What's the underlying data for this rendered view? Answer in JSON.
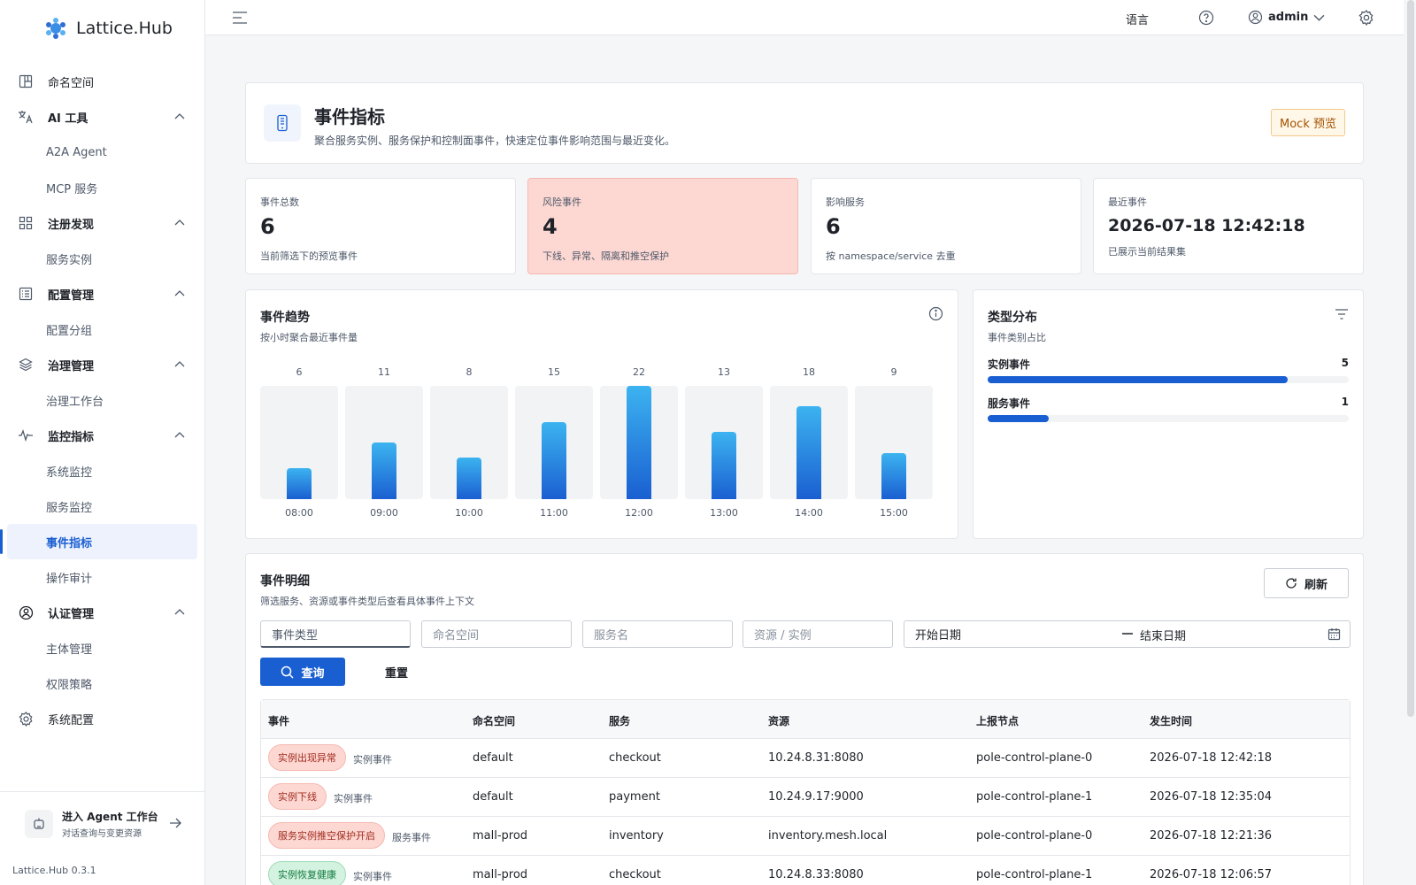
{
  "brand": {
    "name": "Lattice.Hub",
    "version": "Lattice.Hub 0.3.1"
  },
  "nav": {
    "namespace": "命名空间",
    "ai_tools": "AI 工具",
    "a2a": "A2A Agent",
    "mcp": "MCP 服务",
    "registry": "注册发现",
    "service_instance": "服务实例",
    "config": "配置管理",
    "config_group": "配置分组",
    "governance": "治理管理",
    "governance_workbench": "治理工作台",
    "monitoring": "监控指标",
    "system_monitor": "系统监控",
    "service_monitor": "服务监控",
    "event_metrics": "事件指标",
    "audit": "操作审计",
    "auth": "认证管理",
    "principal": "主体管理",
    "policy": "权限策略",
    "system_config": "系统配置"
  },
  "agent_entry": {
    "title": "进入 Agent 工作台",
    "subtitle": "对话查询与变更资源"
  },
  "topbar": {
    "language": "语言",
    "user": "admin"
  },
  "hero": {
    "title": "事件指标",
    "description": "聚合服务实例、服务保护和控制面事件，快速定位事件影响范围与最近变化。",
    "badge": "Mock 预览"
  },
  "stats": [
    {
      "label": "事件总数",
      "value": "6",
      "note": "当前筛选下的预览事件"
    },
    {
      "label": "风险事件",
      "value": "4",
      "note": "下线、异常、隔离和推空保护"
    },
    {
      "label": "影响服务",
      "value": "6",
      "note": "按 namespace/service 去重"
    },
    {
      "label": "最近事件",
      "value": "2026-07-18 12:42:18",
      "note": "已展示当前结果集"
    }
  ],
  "trend": {
    "title": "事件趋势",
    "subtitle": "按小时聚合最近事件量"
  },
  "chart_data": {
    "type": "bar",
    "categories": [
      "08:00",
      "09:00",
      "10:00",
      "11:00",
      "12:00",
      "13:00",
      "14:00",
      "15:00"
    ],
    "values": [
      6,
      11,
      8,
      15,
      22,
      13,
      18,
      9
    ],
    "ylim": [
      0,
      22
    ]
  },
  "distribution": {
    "title": "类型分布",
    "subtitle": "事件类别占比",
    "items": [
      {
        "name": "实例事件",
        "count": "5",
        "fraction": 0.83
      },
      {
        "name": "服务事件",
        "count": "1",
        "fraction": 0.17
      }
    ]
  },
  "detail": {
    "title": "事件明细",
    "subtitle": "筛选服务、资源或事件类型后查看具体事件上下文",
    "refresh": "刷新",
    "filters": {
      "event_type": "事件类型",
      "namespace": "命名空间",
      "service": "服务名",
      "resource": "资源 / 实例",
      "start_date": "开始日期",
      "end_date": "结束日期"
    },
    "query": "查询",
    "reset": "重置",
    "columns": [
      "事件",
      "命名空间",
      "服务",
      "资源",
      "上报节点",
      "发生时间"
    ],
    "rows": [
      {
        "tag": "实例出现异常",
        "category": "实例事件",
        "namespace": "default",
        "service": "checkout",
        "resource": "10.24.8.31:8080",
        "node": "pole-control-plane-0",
        "time": "2026-07-18 12:42:18",
        "status": "risk"
      },
      {
        "tag": "实例下线",
        "category": "实例事件",
        "namespace": "default",
        "service": "payment",
        "resource": "10.24.9.17:9000",
        "node": "pole-control-plane-1",
        "time": "2026-07-18 12:35:04",
        "status": "risk"
      },
      {
        "tag": "服务实例推空保护开启",
        "category": "服务事件",
        "namespace": "mall-prod",
        "service": "inventory",
        "resource": "inventory.mesh.local",
        "node": "pole-control-plane-0",
        "time": "2026-07-18 12:21:36",
        "status": "risk"
      },
      {
        "tag": "实例恢复健康",
        "category": "实例事件",
        "namespace": "mall-prod",
        "service": "checkout",
        "resource": "10.24.8.33:8080",
        "node": "pole-control-plane-1",
        "time": "2026-07-18 12:06:57",
        "status": "ok"
      }
    ]
  },
  "colors": {
    "accent": "#1a5fd1",
    "danger_bg": "#fdd8d3",
    "success_bg": "#d4f2e0"
  }
}
